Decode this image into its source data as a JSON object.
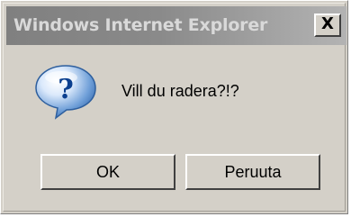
{
  "window": {
    "title": "Windows Internet Explorer",
    "close_label": "X"
  },
  "dialog": {
    "icon": "question-icon",
    "icon_glyph": "?",
    "message": "Vill du radera?!?"
  },
  "buttons": {
    "ok_label": "OK",
    "cancel_label": "Peruuta"
  },
  "colors": {
    "face": "#d4d0c8",
    "title_inactive_start": "#808080",
    "title_inactive_end": "#b3b3b3",
    "icon_blue": "#1a5fb4"
  }
}
